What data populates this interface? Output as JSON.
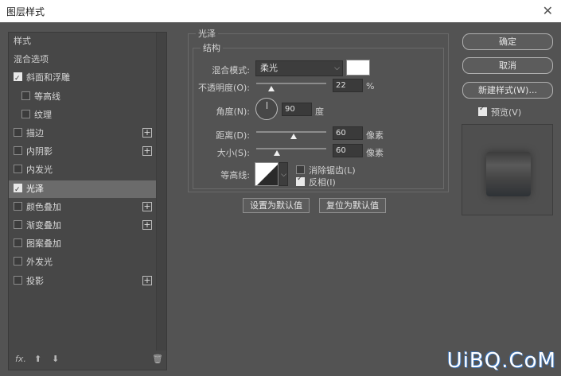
{
  "window": {
    "title": "图层样式"
  },
  "left_panel": {
    "items": [
      {
        "label": "样式",
        "type": "header"
      },
      {
        "label": "混合选项",
        "type": "header"
      },
      {
        "label": "斜面和浮雕",
        "checked": true,
        "plus": false
      },
      {
        "label": "等高线",
        "checked": false,
        "plus": false,
        "indent": true
      },
      {
        "label": "纹理",
        "checked": false,
        "plus": false,
        "indent": true
      },
      {
        "label": "描边",
        "checked": false,
        "plus": true
      },
      {
        "label": "内阴影",
        "checked": false,
        "plus": true
      },
      {
        "label": "内发光",
        "checked": false,
        "plus": false
      },
      {
        "label": "光泽",
        "checked": true,
        "plus": false,
        "selected": true
      },
      {
        "label": "颜色叠加",
        "checked": false,
        "plus": true
      },
      {
        "label": "渐变叠加",
        "checked": false,
        "plus": true
      },
      {
        "label": "图案叠加",
        "checked": false,
        "plus": false
      },
      {
        "label": "外发光",
        "checked": false,
        "plus": false
      },
      {
        "label": "投影",
        "checked": false,
        "plus": true
      }
    ],
    "bottom": {
      "fx": "fx.",
      "up": "⬆",
      "down": "⬇",
      "trash": "🗑"
    }
  },
  "satin": {
    "group_title": "光泽",
    "structure_title": "结构",
    "blend_mode_label": "混合模式:",
    "blend_mode_value": "柔光",
    "opacity_label": "不透明度(O):",
    "opacity_value": "22",
    "opacity_unit": "%",
    "opacity_pct": 22,
    "angle_label": "角度(N):",
    "angle_value": "90",
    "angle_unit": "度",
    "distance_label": "距离(D):",
    "distance_value": "60",
    "distance_unit": "像素",
    "size_label": "大小(S):",
    "size_value": "60",
    "size_unit": "像素",
    "contour_label": "等高线:",
    "antialias_label": "消除锯齿(L)",
    "antialias_checked": false,
    "invert_label": "反相(I)",
    "invert_checked": true,
    "set_default": "设置为默认值",
    "reset_default": "复位为默认值"
  },
  "right": {
    "ok": "确定",
    "cancel": "取消",
    "new_style": "新建样式(W)...",
    "preview_label": "预览(V)",
    "preview_checked": true
  },
  "watermark": "UiBQ.CoM",
  "colors": {
    "bg": "#535353",
    "selected": "#6b6b6b",
    "swatch": "#ffffff"
  }
}
